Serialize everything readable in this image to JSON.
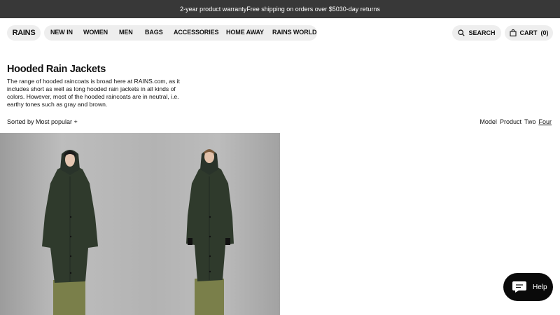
{
  "announcement": {
    "text": "2-year product warrantyFree shipping on orders over $5030-day returns"
  },
  "header": {
    "logo": "RAINS",
    "nav": [
      "NEW IN",
      "WOMEN",
      "MEN",
      "BAGS",
      "ACCESSORIES",
      "HOME AWAY",
      "RAINS WORLD"
    ],
    "search_label": "SEARCH",
    "cart_label": "CART",
    "cart_count": "(0)",
    "icons": {
      "search": "search-icon",
      "cart": "bag-icon"
    }
  },
  "page": {
    "title": "Hooded Rain Jackets",
    "description": "The range of hooded raincoats is broad here at RAINS.com, as it includes short as well as long hooded rain jackets in all kinds of colors. However, most of the hooded raincoats are in neutral, i.e. earthy tones such as gray and brown.",
    "sorted": "Sorted by Most popular +",
    "view_options": [
      "Model",
      "Product",
      "Two",
      "Four"
    ],
    "active_view": "Four"
  },
  "help": {
    "label": "Help",
    "icon": "chat-bubble-icon"
  },
  "colors": {
    "announcement_bg": "#383838",
    "pill_bg": "#eeeeee",
    "jacket": "#2f3a2c",
    "trousers": "#7a7f4a",
    "help_bg": "#0a0a0a"
  }
}
